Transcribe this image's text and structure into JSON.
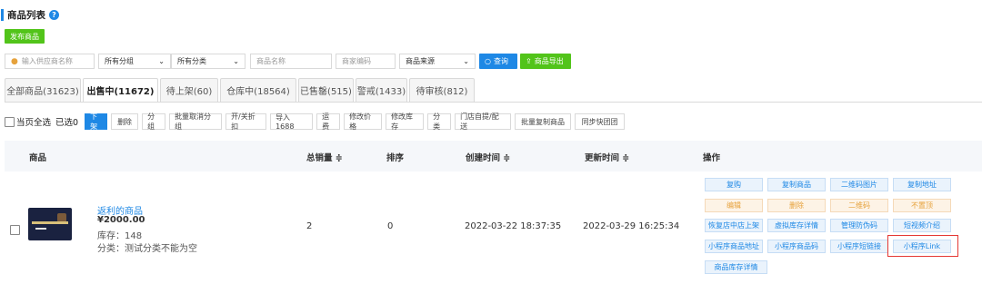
{
  "page": {
    "title": "商品列表",
    "help_icon": "?"
  },
  "publish_button": "发布商品",
  "filters": {
    "supplier_placeholder": "输入供应商名称",
    "group_select": "所有分组",
    "category_select": "所有分类",
    "name_placeholder": "商品名称",
    "code_placeholder": "商家编码",
    "source_select": "商品来源",
    "query_button": "查询",
    "export_button": "商品导出"
  },
  "tabs": [
    {
      "label": "全部商品(31623)"
    },
    {
      "label": "出售中(11672)",
      "active": true
    },
    {
      "label": "待上架(60)"
    },
    {
      "label": "仓库中(18564)"
    },
    {
      "label": "已售罄(515)"
    },
    {
      "label": "警戒(1433)"
    },
    {
      "label": "待审核(812)"
    }
  ],
  "actions": {
    "select_all": "当页全选",
    "selected_count": "已选0",
    "buttons": [
      "下架",
      "删除",
      "分组",
      "批量取消分组",
      "开/关折扣",
      "导入1688",
      "运费",
      "修改价格",
      "修改库存",
      "分类",
      "门店自提/配送",
      "批量复制商品",
      "同步快团团"
    ]
  },
  "table": {
    "headers": {
      "product": "商品",
      "total_sales": "总销量 ≑",
      "sort": "排序",
      "created": "创建时间 ≑",
      "updated": "更新时间 ≑",
      "operations": "操作"
    },
    "rows": [
      {
        "name": "返利的商品",
        "price": "¥2000.00",
        "stock": "库存：148",
        "category": "分类：测试分类不能为空",
        "total_sales": "2",
        "sort": "0",
        "created": "2022-03-22 18:37:35",
        "updated": "2022-03-29 16:25:34",
        "operations": [
          {
            "label": "复购",
            "style": "normal"
          },
          {
            "label": "复制商品",
            "style": "normal"
          },
          {
            "label": "二维码图片",
            "style": "normal"
          },
          {
            "label": "复制地址",
            "style": "normal"
          },
          {
            "label": "编辑",
            "style": "warn"
          },
          {
            "label": "删除",
            "style": "warn"
          },
          {
            "label": "二维码",
            "style": "warn"
          },
          {
            "label": "不置顶",
            "style": "warn"
          },
          {
            "label": "恢复店中店上架",
            "style": "normal"
          },
          {
            "label": "虚拟库存详情",
            "style": "normal"
          },
          {
            "label": "管理防伪码",
            "style": "normal"
          },
          {
            "label": "短视频介绍",
            "style": "normal"
          },
          {
            "label": "小程序商品地址",
            "style": "normal"
          },
          {
            "label": "小程序商品码",
            "style": "normal"
          },
          {
            "label": "小程序短链接",
            "style": "normal"
          },
          {
            "label": "小程序Link",
            "style": "normal",
            "highlighted": true
          },
          {
            "label": "商品库存详情",
            "style": "normal"
          }
        ]
      }
    ]
  },
  "colors": {
    "primary": "#1e88e5",
    "success": "#52c41a",
    "warning": "#e6a23c",
    "highlight": "#e53935"
  }
}
